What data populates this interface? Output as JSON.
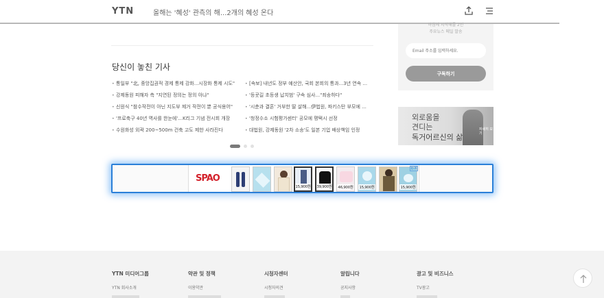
{
  "header": {
    "logo": "YTN",
    "title": "올해는 '혜성' 관측의 해...2개의 혜성 온다"
  },
  "newsletter": {
    "desc_line1": "아침에 시작해를 2인",
    "desc_line2": "주요뉴스 메일 발송",
    "email_placeholder": "Email 주소를 입력하세요.",
    "subscribe_label": "구독하기"
  },
  "side_banner": {
    "line1": "외로움을",
    "line2": "견디는",
    "line3": "독거어르신의 삶",
    "small": "자세히 보기"
  },
  "missed": {
    "title": "당신이 놓친 기사",
    "left": [
      "통일부 \"北, 중앙집권적 경제 통제 강화...시장화 통제 시도\"",
      "강제동원 피해자 측 \"지연된 정의는 정의 아냐\"",
      "신원식 \"참수작전이 아닌 지도부 제거 작전이 뿐 공식용어\"",
      "'프로축구 40년 역사를 한눈에'...K리그 기념 전시회 개장",
      "수원화성 외곽 200~500m 건축 고도 제한 사라진다"
    ],
    "right": [
      "[속보] 내년도 정부 예산안, 국회 본회의 통과...3년 연속 ...",
      "'등굣길 초등생 납치범' 구속 심사...\"죄송하다\"",
      "'시춘과 결혼' 거부한 딸 살해...伊법원, 파키스탄 부모에 ...",
      "'청정수소 시험평가센터' 공모에 평택시 선정",
      "대법원, 강제동원 '2차 소송'도 일본 기업 배상책임 인정"
    ]
  },
  "ad": {
    "brand": "SPAO",
    "flag": "i▷X",
    "prices": [
      "15,900원",
      "39,900원",
      "46,900원",
      "15,900원",
      "15,900원"
    ]
  },
  "footer": {
    "columns": [
      {
        "title": "YTN 미디어그룹",
        "link": "YTN 회사소개"
      },
      {
        "title": "약관 및 정책",
        "link": "이용약관"
      },
      {
        "title": "시청자센터",
        "link": "시청자의견"
      },
      {
        "title": "알립니다",
        "link": "공지사항"
      },
      {
        "title": "광고 및 비즈니스",
        "link": "TV광고"
      }
    ]
  },
  "icons": {
    "share": "share-icon",
    "menu": "menu-icon",
    "top": "arrow-up-icon"
  },
  "colors": {
    "ad_border": "#2a7fd8",
    "brand_red": "#d3212b",
    "subscribe_bg": "#9a9a9a"
  }
}
